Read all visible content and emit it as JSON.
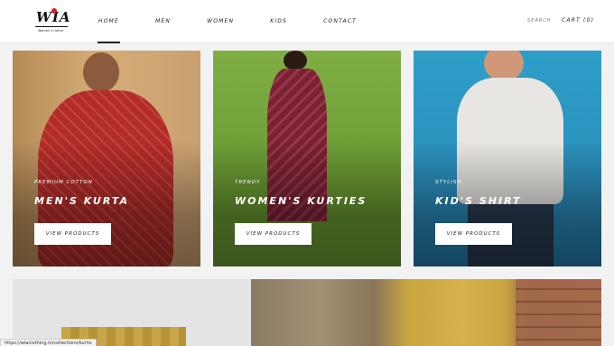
{
  "logo": {
    "text": "WIA",
    "tagline": "Women In Attire"
  },
  "nav": {
    "items": [
      {
        "label": "HOME",
        "active": true
      },
      {
        "label": "MEN",
        "active": false
      },
      {
        "label": "WOMEN",
        "active": false
      },
      {
        "label": "KIDS",
        "active": false
      },
      {
        "label": "CONTACT",
        "active": false
      }
    ],
    "search_label": "SEARCH",
    "cart_label": "CART (0)"
  },
  "cards": [
    {
      "eyebrow": "PREMIUM COTTON",
      "title": "MEN'S KURTA",
      "button": "VIEW PRODUCTS"
    },
    {
      "eyebrow": "TRENDY",
      "title": "WOMEN'S KURTIES",
      "button": "VIEW PRODUCTS"
    },
    {
      "eyebrow": "STYLISH",
      "title": "KID'S SHIRT",
      "button": "VIEW PRODUCTS"
    }
  ],
  "status_url": "https://wiaclothing.in/collections/kurtis",
  "colors": {
    "accent": "#d0202a",
    "button_bg": "#ffffff",
    "header_bg": "#ffffff"
  }
}
